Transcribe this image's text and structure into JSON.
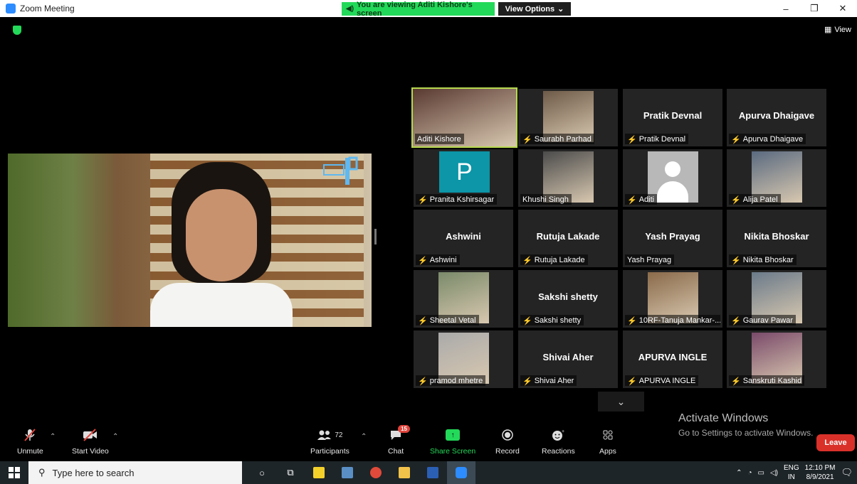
{
  "window": {
    "title": "Zoom Meeting",
    "viewing_banner": "You are viewing Aditi Kishore's screen",
    "view_options": "View Options",
    "controls": [
      "–",
      "❐",
      "✕"
    ]
  },
  "view_button": "View",
  "colors": {
    "accent_green": "#23d959",
    "leave_red": "#d9312a",
    "tile_bg": "#242424",
    "active_speaker": "#b7d94f"
  },
  "gallery": [
    {
      "name": "Aditi Kishore",
      "big": "",
      "muted": false,
      "type": "video"
    },
    {
      "name": "Saurabh Parhad",
      "big": "",
      "muted": true,
      "type": "video"
    },
    {
      "name": "Pratik Devnal",
      "big": "Pratik Devnal",
      "muted": true,
      "type": "name"
    },
    {
      "name": "Apurva Dhaigave",
      "big": "Apurva Dhaigave",
      "muted": true,
      "type": "name"
    },
    {
      "name": "Pranita Kshirsagar",
      "big": "P",
      "muted": true,
      "type": "letter"
    },
    {
      "name": "Khushi Singh",
      "big": "",
      "muted": false,
      "type": "video"
    },
    {
      "name": "Aditi",
      "big": "",
      "muted": true,
      "type": "avatar"
    },
    {
      "name": "Alija Patel",
      "big": "",
      "muted": true,
      "type": "video"
    },
    {
      "name": "Ashwini",
      "big": "Ashwini",
      "muted": true,
      "type": "name"
    },
    {
      "name": "Rutuja Lakade",
      "big": "Rutuja Lakade",
      "muted": true,
      "type": "name"
    },
    {
      "name": "Yash Prayag",
      "big": "Yash Prayag",
      "muted": false,
      "type": "name"
    },
    {
      "name": "Nikita Bhoskar",
      "big": "Nikita Bhoskar",
      "muted": true,
      "type": "name"
    },
    {
      "name": "Sheetal Vetal",
      "big": "",
      "muted": true,
      "type": "video"
    },
    {
      "name": "Sakshi  shetty",
      "big": "Sakshi  shetty",
      "muted": true,
      "type": "name"
    },
    {
      "name": "10RF-Tanuja Mankar-...",
      "big": "",
      "muted": true,
      "type": "video"
    },
    {
      "name": "Gaurav Pawar",
      "big": "",
      "muted": true,
      "type": "video"
    },
    {
      "name": "pramod mhetre",
      "big": "",
      "muted": true,
      "type": "video"
    },
    {
      "name": "Shivai Aher",
      "big": "Shivai Aher",
      "muted": true,
      "type": "name"
    },
    {
      "name": "APURVA INGLE",
      "big": "APURVA INGLE",
      "muted": true,
      "type": "name"
    },
    {
      "name": "Sanskruti Kashid",
      "big": "",
      "muted": true,
      "type": "video"
    }
  ],
  "activate_windows": {
    "title": "Activate Windows",
    "subtitle": "Go to Settings to activate Windows."
  },
  "toolbar": {
    "unmute": "Unmute",
    "start_video": "Start Video",
    "participants": "Participants",
    "participants_count": "72",
    "chat": "Chat",
    "chat_badge": "15",
    "share_screen": "Share Screen",
    "record": "Record",
    "reactions": "Reactions",
    "apps": "Apps",
    "leave": "Leave"
  },
  "taskbar": {
    "search_placeholder": "Type here to search",
    "lang_top": "ENG",
    "lang_bottom": "IN",
    "time": "12:10 PM",
    "date": "8/9/2021"
  }
}
